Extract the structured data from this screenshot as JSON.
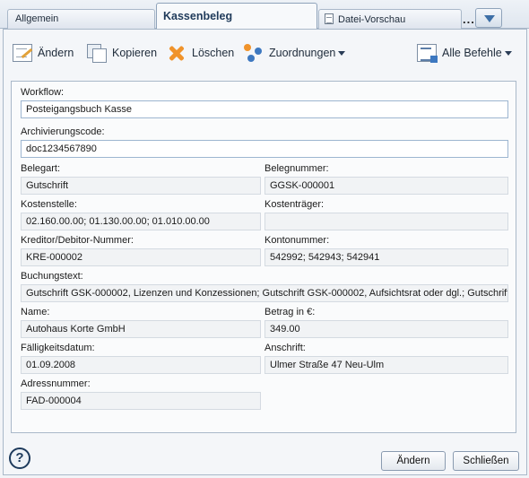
{
  "tabs": {
    "allgemein": "Allgemein",
    "kassenbeleg": "Kassenbeleg",
    "datei_vorschau": "Datei-Vorschau",
    "more": "..."
  },
  "toolbar": {
    "aendern": "Ändern",
    "kopieren": "Kopieren",
    "loeschen": "Löschen",
    "zuordnungen": "Zuordnungen",
    "alle_befehle": "Alle Befehle"
  },
  "form": {
    "workflow": {
      "label": "Workflow:",
      "value": "Posteigangsbuch Kasse"
    },
    "archivierungscode": {
      "label": "Archivierungscode:",
      "value": "doc1234567890"
    },
    "belegart": {
      "label": "Belegart:",
      "value": "Gutschrift"
    },
    "belegnummer": {
      "label": "Belegnummer:",
      "value": "GGSK-000001"
    },
    "kostenstelle": {
      "label": "Kostenstelle:",
      "value": "02.160.00.00; 01.130.00.00; 01.010.00.00"
    },
    "kostentraeger": {
      "label": "Kostenträger:",
      "value": ""
    },
    "kreditor": {
      "label": "Kreditor/Debitor-Nummer:",
      "value": "KRE-000002"
    },
    "kontonummer": {
      "label": "Kontonummer:",
      "value": "542992; 542943; 542941"
    },
    "buchungstext": {
      "label": "Buchungstext:",
      "value": "Gutschrift GSK-000002, Lizenzen und Konzessionen; Gutschrift GSK-000002, Aufsichtsrat oder dgl.; Gutschrift G"
    },
    "name": {
      "label": "Name:",
      "value": "Autohaus Korte GmbH"
    },
    "betrag": {
      "label": "Betrag in €:",
      "value": "349.00"
    },
    "faelligkeitsdatum": {
      "label": "Fälligkeitsdatum:",
      "value": "01.09.2008"
    },
    "anschrift": {
      "label": "Anschrift:",
      "value": "Ulmer Straße 47 Neu-Ulm"
    },
    "adressnummer": {
      "label": "Adressnummer:",
      "value": "FAD-000004"
    }
  },
  "footer": {
    "help": "?",
    "aendern": "Ändern",
    "schliessen": "Schließen"
  }
}
